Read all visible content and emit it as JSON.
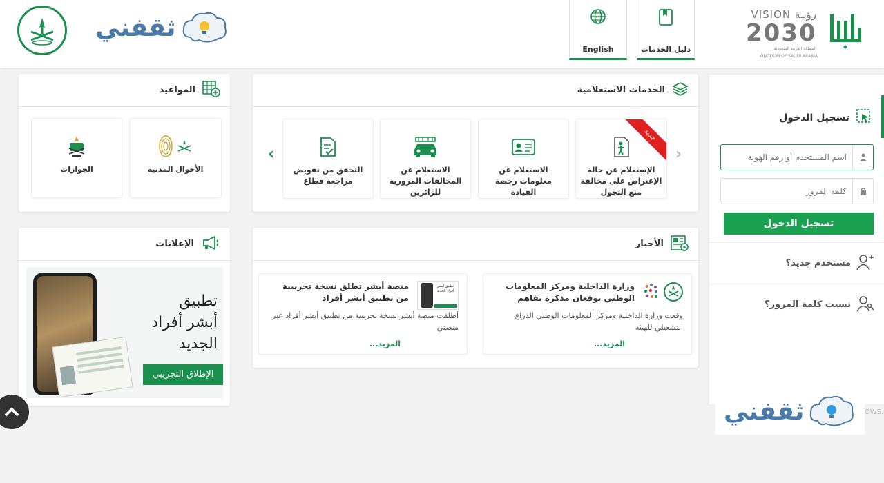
{
  "header": {
    "brand": "ثقفني",
    "btn_english": "English",
    "btn_services_guide": "دليل الخدمات",
    "vision_title": "VISION رؤيـة",
    "vision_year": "2030",
    "vision_ar": "المملكة العربية السعودية",
    "vision_en": "KINGDOM OF SAUDI ARABIA"
  },
  "services": {
    "title": "الخدمات الاستعلامية",
    "new_badge": "جديد",
    "items": [
      {
        "label": "الإستعلام عن حالة الإعتراض على مخالفة منع التجول"
      },
      {
        "label": "الاستعلام عن معلومات رخصة القيادة"
      },
      {
        "label": "الاستعلام عن المخالفات المرورية للزائرين"
      },
      {
        "label": "التحقق من تفويض مراجعة قطاع"
      }
    ]
  },
  "appointments": {
    "title": "المواعيد",
    "items": [
      {
        "label": "الأحوال المدنية"
      },
      {
        "label": "الجوازات"
      }
    ],
    "logo_text": "الأحوال المدنية"
  },
  "news": {
    "title": "الأخبار",
    "items": [
      {
        "title": "وزارة الداخلية ومركز المعلومات الوطني يوقعان مذكرة تفاهم",
        "desc": "وقعت وزارة الداخلية ومركز المعلومات الوطني الذراع التشغيلي للهيئة",
        "more": "المزيد..."
      },
      {
        "title": "منصة أبشر تطلق نسخة تجريبية من تطبيق أبشر أفراد",
        "desc": "أطلقت منصة أبشر نسخة تجريبية من تطبيق أبشر أفراد عبر منصتي",
        "more": "المزيد..."
      }
    ],
    "thumb_text": "تطبيق أبشر أفراد الجديد"
  },
  "ads": {
    "title": "الإعلانات",
    "line1": "تطبيق",
    "line2": "أبشر أفراد",
    "line3": "الجديد",
    "launch": "الإطلاق التجريبي"
  },
  "login": {
    "title": "تسجيل الدخول",
    "username_placeholder": "اسم المستخدم أو رقم الهوية",
    "password_placeholder": "كلمة المرور",
    "submit": "تسجيل الدخول",
    "new_user": "مستخدم جديد؟",
    "forgot": "نسيت كلمة المرور؟"
  },
  "watermark": {
    "brand": "ثقفني",
    "fade": "OWS."
  },
  "colors": {
    "accent": "#1a8f4e",
    "button": "#1aa252",
    "brand": "#4a7aa8",
    "badge": "#e02020"
  }
}
